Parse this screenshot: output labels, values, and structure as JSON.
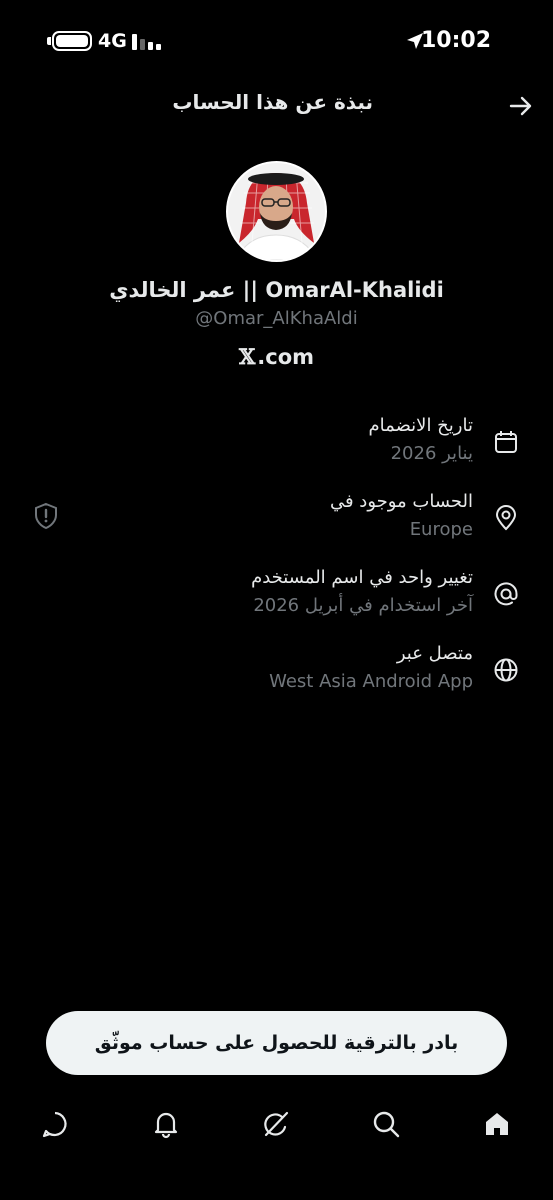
{
  "status_bar": {
    "network": "4G",
    "time": "10:02"
  },
  "header": {
    "title": "نبذة عن هذا الحساب",
    "back_icon": "arrow-right-icon"
  },
  "profile": {
    "name": "عمر الخالدي || OmarAl-Khalidi",
    "handle": "@Omar_AlKhaAldi",
    "site_glyph": "𝕏",
    "site_text": ".com"
  },
  "info": [
    {
      "icon": "calendar-icon",
      "label": "تاريخ الانضمام",
      "value": "يناير 2026"
    },
    {
      "icon": "location-pin-icon",
      "label": "الحساب موجود في",
      "value": "Europe"
    },
    {
      "icon": "at-sign-icon",
      "label": "تغيير واحد في اسم المستخدم",
      "value": "آخر استخدام في أبريل 2026"
    },
    {
      "icon": "globe-icon",
      "label": "متصل عبر",
      "value": "West Asia Android App"
    }
  ],
  "upgrade_button": "بادر بالترقية للحصول على حساب موثّق",
  "nav": [
    "home-icon",
    "search-icon",
    "grok-icon",
    "notifications-icon",
    "messages-icon"
  ],
  "colors": {
    "background": "#000000",
    "primary_text": "#e7e9ea",
    "secondary_text": "#71767b",
    "button_bg": "#eff3f4"
  }
}
